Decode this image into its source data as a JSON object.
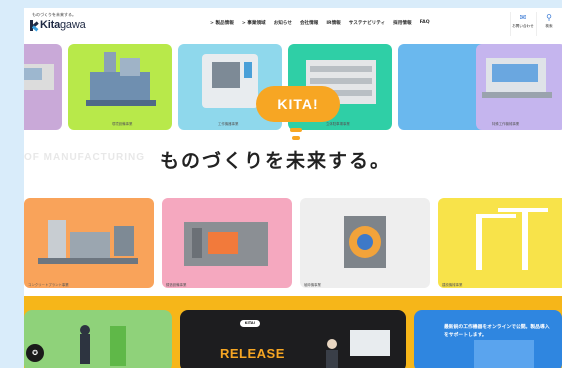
{
  "header": {
    "tagline": "ものづくりを未来する。",
    "logo_bold": "Kita",
    "logo_rest": "gawa",
    "nav": [
      "> 製品情報",
      "> 事業領域",
      "お知らせ",
      "会社情報",
      "IR情報",
      "サステナビリティ",
      "採用情報",
      "FAQ"
    ],
    "contact_label": "お問い合わせ",
    "search_label": "検索"
  },
  "top_row_captions": [
    "環境設備事業",
    "工作機器事業",
    "立体駐車場事業",
    "特殊工作機械事業"
  ],
  "hero": {
    "bubble": "KITA!",
    "bg_text": "OF MANUFACTURING",
    "slogan": "ものづくりを未来する。"
  },
  "middle_row_captions": [
    "コンクリートプラント事業",
    "鋳造設備事業",
    "破砕機事業",
    "建設機械事業"
  ],
  "bottom": {
    "pill": "KITA!",
    "release": "RELEASE",
    "blue_text": "最新鋭の工作機器をオンラインで公開。製品導入をサポートします。"
  },
  "colors": {
    "accent_orange": "#f7a623",
    "band_yellow": "#f6b619",
    "nav_blue": "#3b7bd6"
  }
}
